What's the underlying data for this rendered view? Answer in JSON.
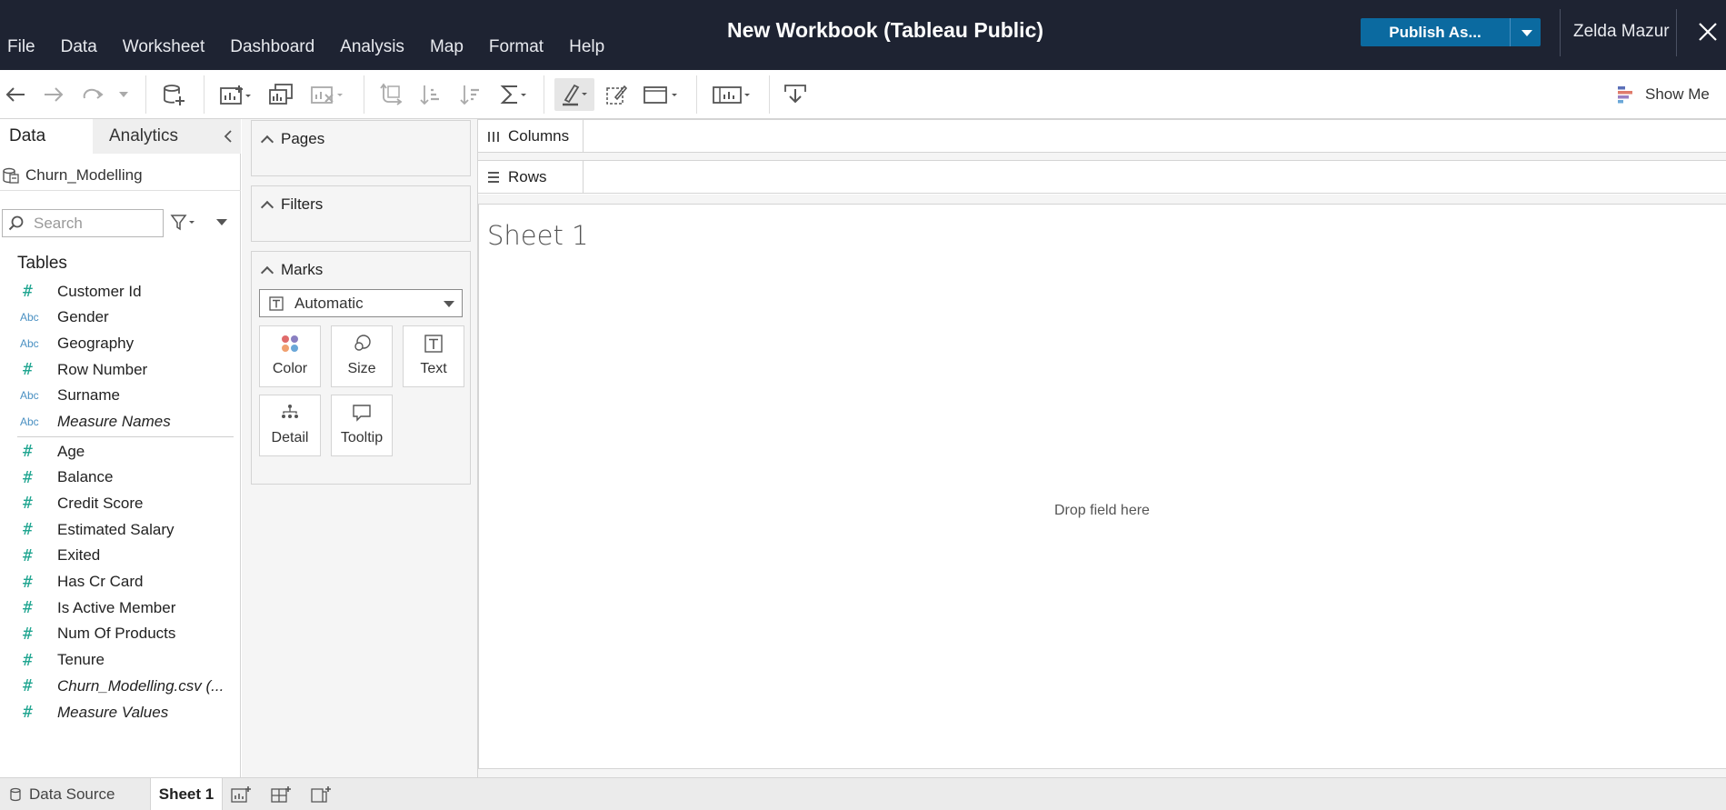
{
  "menu": [
    "File",
    "Data",
    "Worksheet",
    "Dashboard",
    "Analysis",
    "Map",
    "Format",
    "Help"
  ],
  "window_title": "New Workbook (Tableau Public)",
  "publish_label": "Publish As...",
  "user_name": "Zelda Mazur",
  "toolbar": {
    "show_me_label": "Show Me"
  },
  "data_pane": {
    "tab_data": "Data",
    "tab_analytics": "Analytics",
    "datasource_name": "Churn_Modelling",
    "search_placeholder": "Search",
    "tables_heading": "Tables",
    "dimensions": [
      {
        "type": "#",
        "name": "Customer Id",
        "italic": false
      },
      {
        "type": "Abc",
        "name": "Gender",
        "italic": false
      },
      {
        "type": "Abc",
        "name": "Geography",
        "italic": false
      },
      {
        "type": "#",
        "name": "Row Number",
        "italic": false
      },
      {
        "type": "Abc",
        "name": "Surname",
        "italic": false
      },
      {
        "type": "Abc",
        "name": "Measure Names",
        "italic": true
      }
    ],
    "measures": [
      {
        "type": "#",
        "name": "Age",
        "italic": false
      },
      {
        "type": "#",
        "name": "Balance",
        "italic": false
      },
      {
        "type": "#",
        "name": "Credit Score",
        "italic": false
      },
      {
        "type": "#",
        "name": "Estimated Salary",
        "italic": false
      },
      {
        "type": "#",
        "name": "Exited",
        "italic": false
      },
      {
        "type": "#",
        "name": "Has Cr Card",
        "italic": false
      },
      {
        "type": "#",
        "name": "Is Active Member",
        "italic": false
      },
      {
        "type": "#",
        "name": "Num Of Products",
        "italic": false
      },
      {
        "type": "#",
        "name": "Tenure",
        "italic": false
      },
      {
        "type": "#",
        "name": "Churn_Modelling.csv (...",
        "italic": true
      },
      {
        "type": "#",
        "name": "Measure Values",
        "italic": true
      }
    ]
  },
  "cards": {
    "pages": "Pages",
    "filters": "Filters",
    "marks": "Marks",
    "mark_type": "Automatic",
    "buttons": {
      "color": "Color",
      "size": "Size",
      "text": "Text",
      "detail": "Detail",
      "tooltip": "Tooltip"
    }
  },
  "shelves": {
    "columns": "Columns",
    "rows": "Rows"
  },
  "sheet": {
    "title": "Sheet 1",
    "drop_hint": "Drop field here"
  },
  "bottom_tabs": {
    "data_source": "Data Source",
    "sheet": "Sheet 1"
  }
}
